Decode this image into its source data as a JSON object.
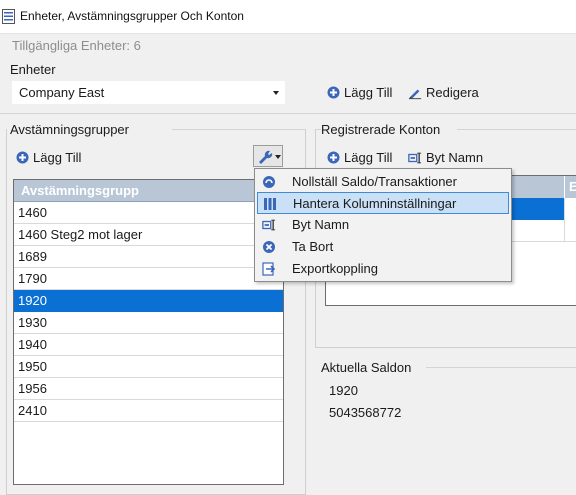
{
  "window": {
    "title": "Enheter, Avstämningsgrupper Och Konton",
    "icon": "app-document-icon"
  },
  "available_units": "Tillgängliga Enheter: 6",
  "units": {
    "label": "Enheter",
    "selected": "Company East",
    "add_label": "Lägg Till",
    "edit_label": "Redigera"
  },
  "groups": {
    "label": "Avstämningsgrupper",
    "add_label": "Lägg Till",
    "column_header": "Avstämningsgrupp",
    "rows": [
      "1460",
      "1460 Steg2 mot lager",
      "1689",
      "1790",
      "1920",
      "1930",
      "1940",
      "1950",
      "1956",
      "2410"
    ],
    "selected_row": "1920"
  },
  "accounts": {
    "label": "Registrerade Konton",
    "add_label": "Lägg Till",
    "rename_label": "Byt Namn",
    "grid_header_col2": "E"
  },
  "context_menu": {
    "items": [
      {
        "label": "Nollställ Saldo/Transaktioner",
        "icon": "reset-circle-icon"
      },
      {
        "label": "Hantera Kolumninställningar",
        "icon": "columns-icon"
      },
      {
        "label": "Byt Namn",
        "icon": "rename-icon"
      },
      {
        "label": "Ta Bort",
        "icon": "delete-circle-icon"
      },
      {
        "label": "Exportkoppling",
        "icon": "export-icon"
      }
    ],
    "highlighted": "Hantera Kolumninställningar"
  },
  "balances": {
    "label": "Aktuella Saldon",
    "account": "1920",
    "amount": "5043568772"
  },
  "colors": {
    "accent": "#0a70d4",
    "header_bg": "#b9c6d6",
    "icon_blue": "#3b67b8",
    "menu_highlight": "#c9e0f7"
  }
}
